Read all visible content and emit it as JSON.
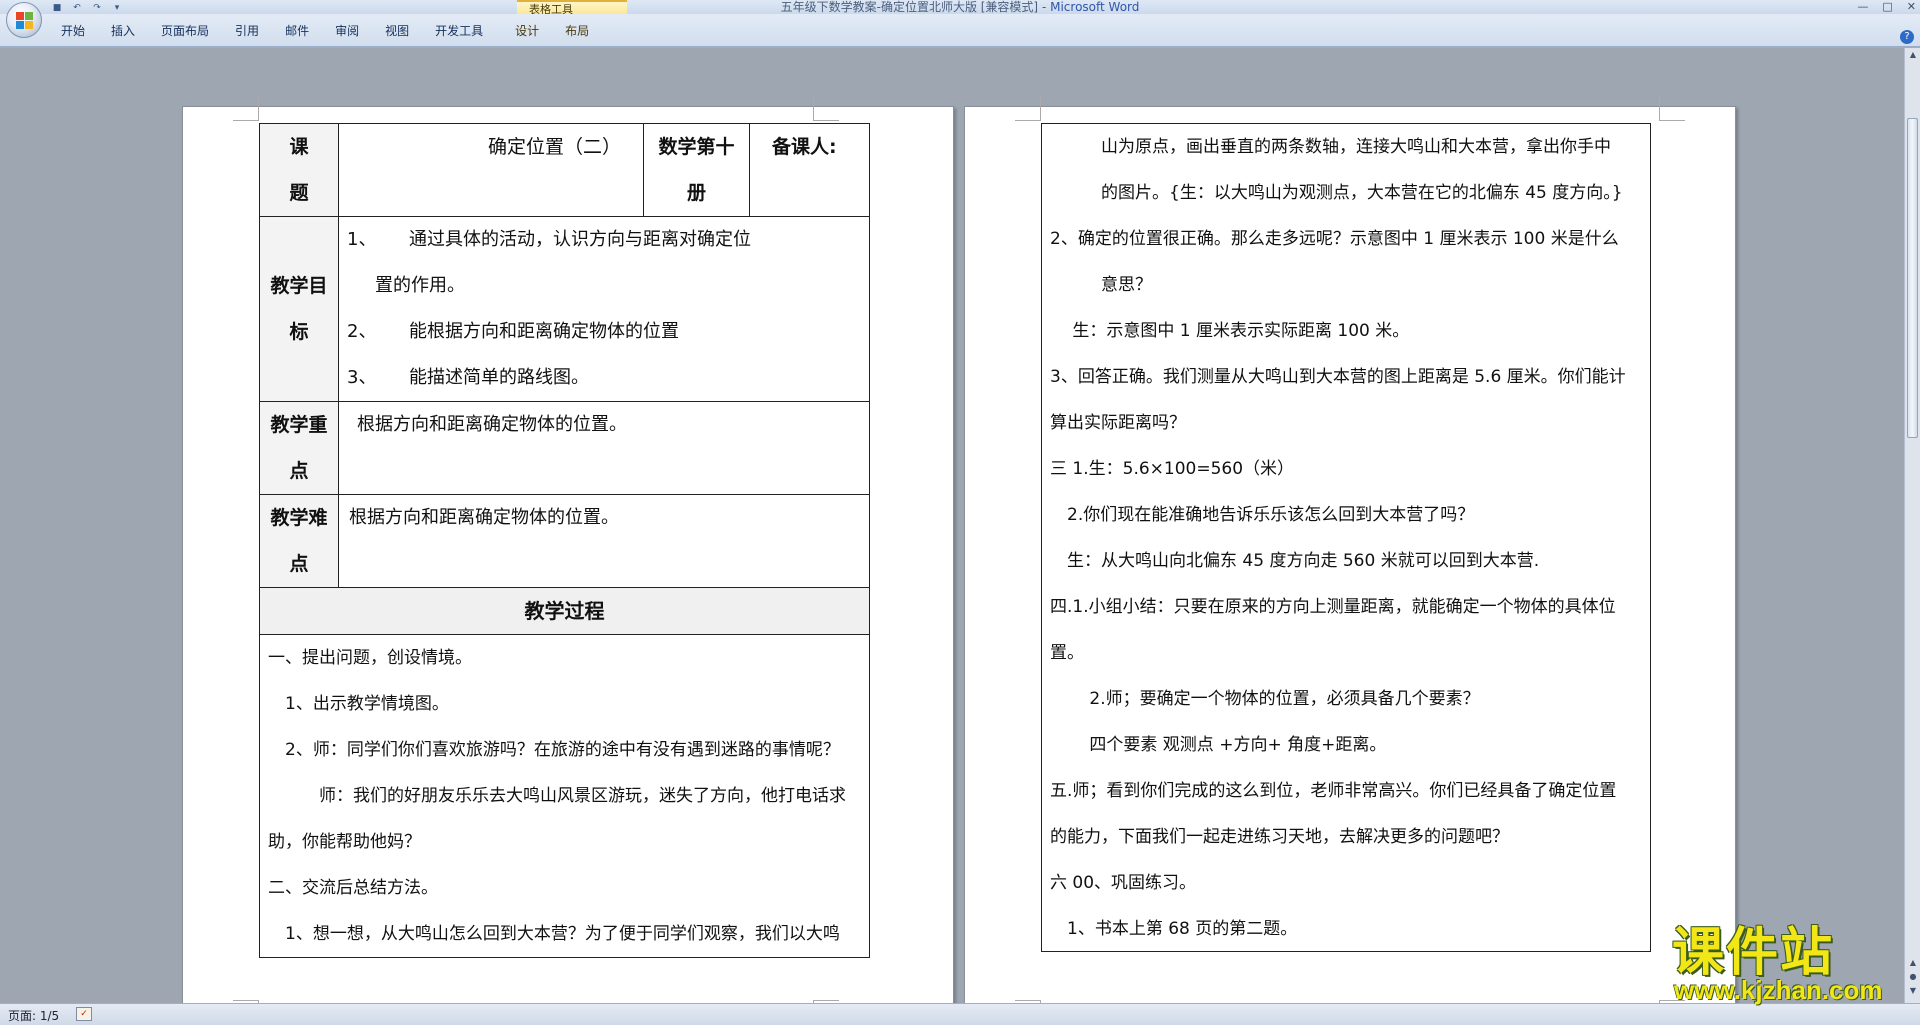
{
  "window": {
    "title": "五年级下数学教案-确定位置北师大版 [兼容模式]",
    "app": "Microsoft Word",
    "controls": [
      "—",
      "□",
      "✕"
    ]
  },
  "qat": {
    "save": "■",
    "undo": "↶",
    "redo": "↷",
    "more": "▾"
  },
  "ribbon": {
    "context_group": "表格工具",
    "tabs": [
      "开始",
      "插入",
      "页面布局",
      "引用",
      "邮件",
      "审阅",
      "视图",
      "开发工具",
      "设计",
      "布局"
    ],
    "help": "?"
  },
  "table": {
    "row1": {
      "label_top": "课",
      "label_bottom": "题",
      "title": "确定位置（二）",
      "book": "数学第十",
      "book_cont": "册",
      "preparer": "备课人:"
    },
    "row2": {
      "label_top": "教学目",
      "label_bottom": "标",
      "items": [
        {
          "num": "1、",
          "text": "通过具体的活动，认识方向与距离对确定位",
          "cont": "置的作用。"
        },
        {
          "num": "2、",
          "text": "能根据方向和距离确定物体的位置"
        },
        {
          "num": "3、",
          "text": "能描述简单的路线图。"
        }
      ]
    },
    "row3": {
      "label_top": "教学重",
      "label_bottom": "点",
      "text": "根据方向和距离确定物体的位置。"
    },
    "row4": {
      "label_top": "教学难",
      "label_bottom": "点",
      "text": "根据方向和距离确定物体的位置。"
    },
    "process_title": "教学过程",
    "process_lines": [
      "一、提出问题，创设情境。",
      "　1、出示教学情境图。",
      "　2、师：同学们你们喜欢旅游吗？在旅游的途中有没有遇到迷路的事情呢？",
      "　　　师：我们的好朋友乐乐去大鸣山风景区游玩，迷失了方向，他打电话求",
      "助，你能帮助他妈？",
      "二、交流后总结方法。",
      "　1、想一想，从大鸣山怎么回到大本营？为了便于同学们观察，我们以大鸣"
    ]
  },
  "right_lines": [
    "　　　山为原点，画出垂直的两条数轴，连接大鸣山和大本营，拿出你手中",
    "　　　的图片。{生：以大鸣山为观测点，大本营在它的北偏东 45 度方向。}",
    " 2、确定的位置很正确。那么走多远呢？示意图中 1 厘米表示 100 米是什么",
    "　　　意思？",
    "　 生：示意图中 1 厘米表示实际距离 100 米。",
    "3、回答正确。我们测量从大鸣山到大本营的图上距离是 5.6 厘米。你们能计",
    "算出实际距离吗？",
    "三 1.生：5.6×100=560（米）",
    "　2.你们现在能准确地告诉乐乐该怎么回到大本营了吗？",
    "　生：从大鸣山向北偏东 45 度方向走 560 米就可以回到大本营.",
    "四.1.小组小结：只要在原来的方向上测量距离，就能确定一个物体的具体位",
    "置。",
    "　　 2.师；要确定一个物体的位置，必须具备几个要素？",
    "　　 四个要素 观测点 +方向+ 角度+距离。",
    "五.师；看到你们完成的这么到位，老师非常高兴。你们已经具备了确定位置",
    "的能力，下面我们一起走进练习天地，去解决更多的问题吧？",
    "六 00、巩固练习。",
    "　1、书本上第 68 页的第二题。"
  ],
  "status": {
    "page": "页面: 1/5"
  },
  "watermark": {
    "title": "课件站",
    "url": "www.kjzhan.com"
  }
}
